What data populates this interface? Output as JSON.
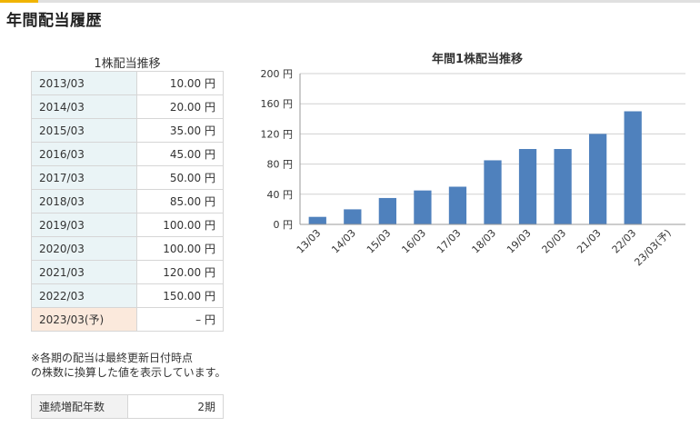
{
  "page": {
    "title": "年間配当履歴"
  },
  "table": {
    "caption": "1株配当推移",
    "rows": [
      {
        "year": "2013/03",
        "amount": "10.00 円"
      },
      {
        "year": "2014/03",
        "amount": "20.00 円"
      },
      {
        "year": "2015/03",
        "amount": "35.00 円"
      },
      {
        "year": "2016/03",
        "amount": "45.00 円"
      },
      {
        "year": "2017/03",
        "amount": "50.00 円"
      },
      {
        "year": "2018/03",
        "amount": "85.00 円"
      },
      {
        "year": "2019/03",
        "amount": "100.00 円"
      },
      {
        "year": "2020/03",
        "amount": "100.00 円"
      },
      {
        "year": "2021/03",
        "amount": "120.00 円"
      },
      {
        "year": "2022/03",
        "amount": "150.00 円"
      },
      {
        "year": "2023/03(予)",
        "amount": "– 円"
      }
    ]
  },
  "note": {
    "line1": "※各期の配当は最終更新日付時点",
    "line2": "の株数に換算した値を表示しています。"
  },
  "streak": {
    "label": "連続増配年数",
    "value": "2期"
  },
  "colors": {
    "bar": "#4f81bd",
    "accent": "#f0b400",
    "year_cell": "#eaf4f6",
    "forecast_cell": "#fbe9dc"
  },
  "chart_data": {
    "type": "bar",
    "title": "年間1株配当推移",
    "categories": [
      "13/03",
      "14/03",
      "15/03",
      "16/03",
      "17/03",
      "18/03",
      "19/03",
      "20/03",
      "21/03",
      "22/03",
      "23/03(予)"
    ],
    "values": [
      10,
      20,
      35,
      45,
      50,
      85,
      100,
      100,
      120,
      150,
      null
    ],
    "ylim": [
      0,
      200
    ],
    "yticks": [
      0,
      40,
      80,
      120,
      160,
      200
    ],
    "ytick_labels": [
      "0 円",
      "40 円",
      "80 円",
      "120 円",
      "160 円",
      "200 円"
    ],
    "grid": true,
    "xlabel": "",
    "ylabel": ""
  }
}
